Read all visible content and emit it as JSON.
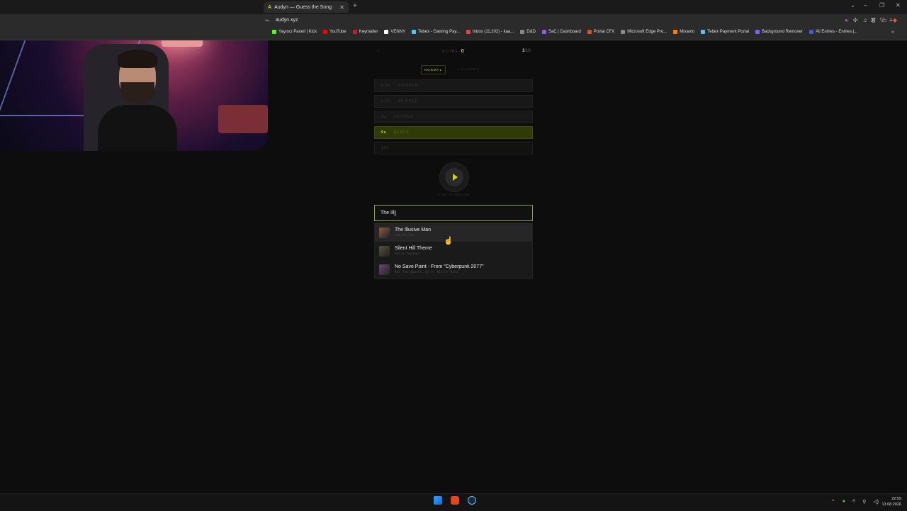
{
  "browser": {
    "tab_title": "Audyn — Guess the Song",
    "url": "audyn.xyz",
    "bookmarks": [
      {
        "label": "Yayıncı Paneli | Kick",
        "color": "#53fc18"
      },
      {
        "label": "YouTube",
        "color": "#ff0000"
      },
      {
        "label": "Keymailer",
        "color": "#c02030"
      },
      {
        "label": "VENNY",
        "color": "#ffffff"
      },
      {
        "label": "Tebex - Gaming Pay...",
        "color": "#4fc3f7"
      },
      {
        "label": "Inbox (11,202) - kaa...",
        "color": "#ea4335"
      },
      {
        "label": "D&D",
        "color": "#888888"
      },
      {
        "label": "SaC | Dashboard",
        "color": "#8a5cf6"
      },
      {
        "label": "Portal CFX",
        "color": "#e05020"
      },
      {
        "label": "Microsoft Edge Pro...",
        "color": "#888888"
      },
      {
        "label": "Mixamo",
        "color": "#ff7a00"
      },
      {
        "label": "Tebex Payment Portal",
        "color": "#4fc3f7"
      },
      {
        "label": "Background Remover",
        "color": "#7b61ff"
      },
      {
        "label": "All Entries - Entries |...",
        "color": "#3b5bdb"
      }
    ]
  },
  "game": {
    "back_label": "←",
    "score_label": "SCORE",
    "score_value": "0",
    "counter_current": "1",
    "counter_total": "/10",
    "mode_normal": "NORMAL",
    "mode_classic": "♫ CLASSIC",
    "attempts": [
      {
        "time": "0.5s",
        "status": "SKIPPED"
      },
      {
        "time": "1.5s",
        "status": "SKIPPED"
      },
      {
        "time": "3s",
        "status": "SKIPPED"
      },
      {
        "time": "9s",
        "status": "READY"
      },
      {
        "time": "15s",
        "status": ""
      }
    ],
    "tap_hint": "⟲ TAP TO PREVIEW",
    "search_value": "The Ill"
  },
  "suggestions": [
    {
      "title": "The Illusive Man",
      "sub": "Sam Hulick",
      "color": "#8a5a40"
    },
    {
      "title": "Silent Hill Theme",
      "sub": "Akira Yamaoka",
      "color": "#5a5040"
    },
    {
      "title": "No Save Point - From \"Cyberpunk 2077\"",
      "sub": "Run The Jewels, El-P, Killer Mike",
      "color": "#6a4a70"
    }
  ],
  "system": {
    "time": "22:59",
    "date": "13.08.2026"
  }
}
